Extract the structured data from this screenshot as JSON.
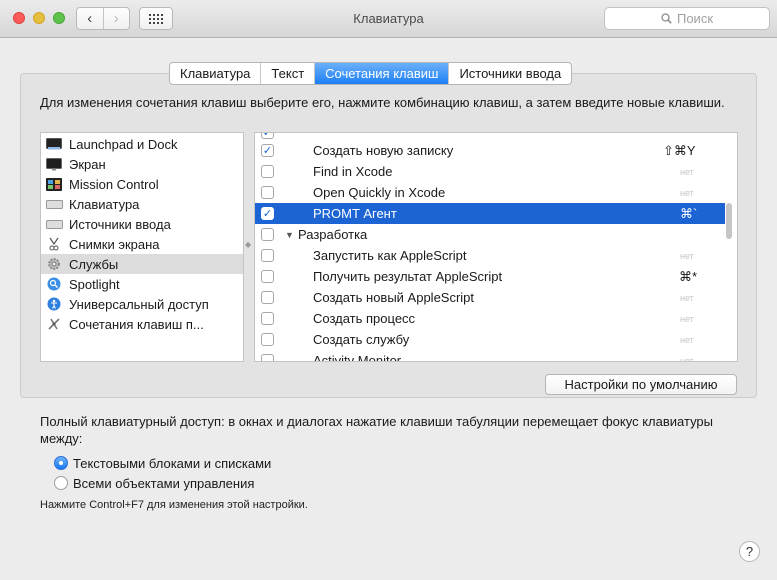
{
  "window": {
    "title": "Клавиатура",
    "search_placeholder": "Поиск"
  },
  "tabs": [
    {
      "label": "Клавиатура",
      "active": false
    },
    {
      "label": "Текст",
      "active": false
    },
    {
      "label": "Сочетания клавиш",
      "active": true
    },
    {
      "label": "Источники ввода",
      "active": false
    }
  ],
  "instruction": "Для изменения сочетания клавиш выберите его, нажмите комбинацию клавиш, а затем введите новые клавиши.",
  "categories": [
    {
      "label": "Launchpad и Dock",
      "icon": "launchpad-icon",
      "selected": false
    },
    {
      "label": "Экран",
      "icon": "display-icon",
      "selected": false
    },
    {
      "label": "Mission Control",
      "icon": "mission-control-icon",
      "selected": false
    },
    {
      "label": "Клавиатура",
      "icon": "keyboard-icon",
      "selected": false
    },
    {
      "label": "Источники ввода",
      "icon": "input-sources-icon",
      "selected": false
    },
    {
      "label": "Снимки экрана",
      "icon": "screenshot-icon",
      "selected": false
    },
    {
      "label": "Службы",
      "icon": "gear-icon",
      "selected": true
    },
    {
      "label": "Spotlight",
      "icon": "spotlight-icon",
      "selected": false
    },
    {
      "label": "Универсальный доступ",
      "icon": "accessibility-icon",
      "selected": false
    },
    {
      "label": "Сочетания клавиш п...",
      "icon": "app-shortcuts-icon",
      "selected": false
    }
  ],
  "shortcuts": [
    {
      "label": "Создать новую записку",
      "checked": true,
      "key": "⇧⌘Y",
      "group": false,
      "selected": false
    },
    {
      "label": "Find in Xcode",
      "checked": false,
      "key": "нет",
      "group": false,
      "selected": false
    },
    {
      "label": "Open Quickly in Xcode",
      "checked": false,
      "key": "нет",
      "group": false,
      "selected": false
    },
    {
      "label": "PROMT Агент",
      "checked": true,
      "key": "⌘`",
      "group": false,
      "selected": true
    },
    {
      "label": "Разработка",
      "checked": false,
      "key": "",
      "group": true,
      "selected": false
    },
    {
      "label": "Запустить как AppleScript",
      "checked": false,
      "key": "нет",
      "group": false,
      "selected": false
    },
    {
      "label": "Получить результат AppleScript",
      "checked": false,
      "key": "⌘*",
      "group": false,
      "selected": false
    },
    {
      "label": "Создать новый AppleScript",
      "checked": false,
      "key": "нет",
      "group": false,
      "selected": false
    },
    {
      "label": "Создать процесс",
      "checked": false,
      "key": "нет",
      "group": false,
      "selected": false
    },
    {
      "label": "Создать службу",
      "checked": false,
      "key": "нет",
      "group": false,
      "selected": false
    },
    {
      "label": "Activity Monitor",
      "checked": false,
      "key": "нет",
      "group": false,
      "selected": false
    }
  ],
  "defaults_button": "Настройки по умолчанию",
  "full_keyboard_access": {
    "description": "Полный клавиатурный доступ: в окнах и диалогах нажатие клавиши табуляции перемещает фокус клавиатуры между:",
    "options": [
      {
        "label": "Текстовыми блоками и списками",
        "selected": true
      },
      {
        "label": "Всеми объектами управления",
        "selected": false
      }
    ],
    "hint": "Нажмите Control+F7 для изменения этой настройки."
  },
  "colors": {
    "accent": "#1c64d4",
    "tab_active": "#1d7ff5"
  }
}
